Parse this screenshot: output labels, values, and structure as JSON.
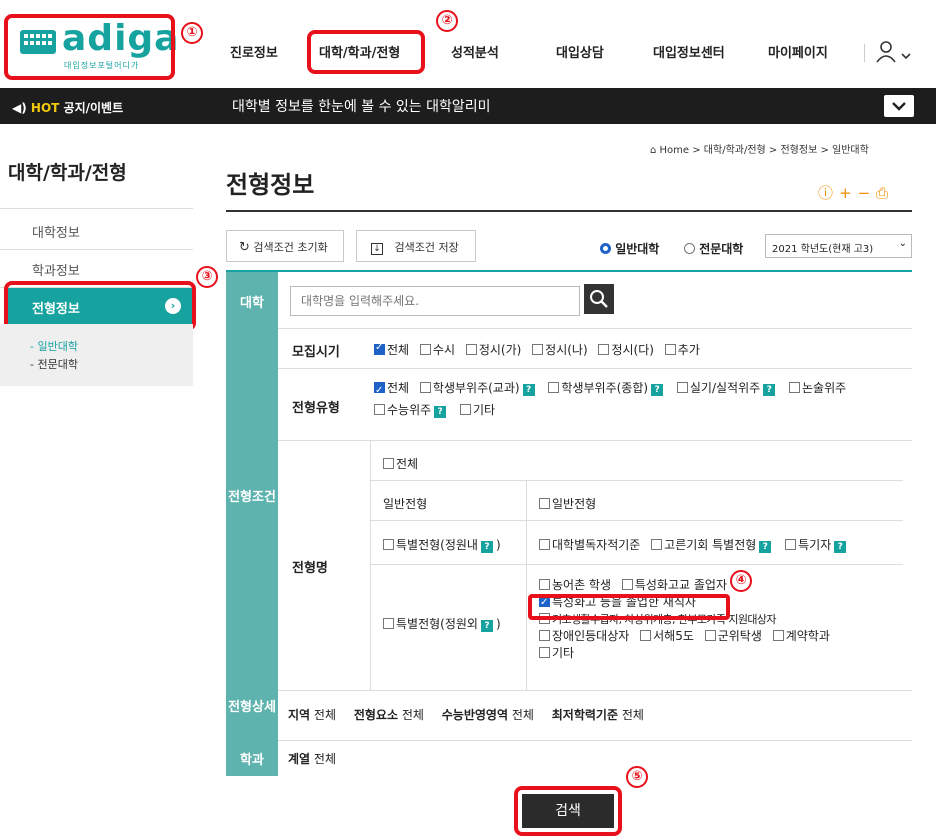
{
  "logo": {
    "brand": "adiga",
    "sub": "대입정보포털어디가"
  },
  "nav": {
    "items": [
      "진로정보",
      "대학/학과/전형",
      "성적분석",
      "대입상담",
      "대입정보센터",
      "마이페이지"
    ]
  },
  "hotbar": {
    "hot": "HOT",
    "title": "공지/이벤트",
    "ticker": "대학별 정보를 한눈에 볼 수 있는 대학알리미"
  },
  "breadcrumb": "Home >  대학/학과/전형 >  전형정보 >  일반대학",
  "sidebar": {
    "title": "대학/학과/전형",
    "items": [
      "대학정보",
      "학과정보"
    ],
    "active": "전형정보",
    "sub": [
      "- 일반대학",
      "- 전문대학"
    ]
  },
  "page_title": "전형정보",
  "toolbar": {
    "reset": "검색조건 초기화",
    "save": "검색조건 저장",
    "radio_general": "일반대학",
    "radio_college": "전문대학",
    "year": "2021 학년도(현재 고3)"
  },
  "form": {
    "univ_label": "대학",
    "univ_placeholder": "대학명을 입력해주세요.",
    "cond_label": "전형조건",
    "detail_label": "전형상세",
    "dept_label": "학과",
    "period_label": "모집시기",
    "period_opts": [
      "전체",
      "수시",
      "정시(가)",
      "정시(나)",
      "정시(다)",
      "추가"
    ],
    "type_label": "전형유형",
    "type_opts": [
      "전체",
      "학생부위주(교과)",
      "학생부위주(종합)",
      "실기/실적위주",
      "논술위주",
      "수능위주",
      "기타"
    ],
    "name_label": "전형명",
    "name_all": "전체",
    "general": "일반전형",
    "general_opt": "일반전형",
    "special_in": "특별전형(정원내",
    "special_in_opts": [
      "대학별독자적기준",
      "고른기회 특별전형",
      "특기자"
    ],
    "special_out": "특별전형(정원외",
    "special_out_opts": [
      "농어촌 학생",
      "특성화고교 졸업자",
      "특성화고 등을 졸업한 재직자",
      "기초생활수급자, 차상위계층, 한부모가족 지원대상자",
      "장애인등대상자",
      "서해5도",
      "군위탁생",
      "계약학과",
      "기타"
    ],
    "detail_items": [
      {
        "k": "지역",
        "v": "전체"
      },
      {
        "k": "전형요소",
        "v": "전체"
      },
      {
        "k": "수능반영영역",
        "v": "전체"
      },
      {
        "k": "최저학력기준",
        "v": "전체"
      }
    ],
    "dept_items": [
      {
        "k": "계열",
        "v": "전체"
      }
    ]
  },
  "search_label": "검색",
  "callouts": [
    "①",
    "②",
    "③",
    "④",
    "⑤"
  ]
}
